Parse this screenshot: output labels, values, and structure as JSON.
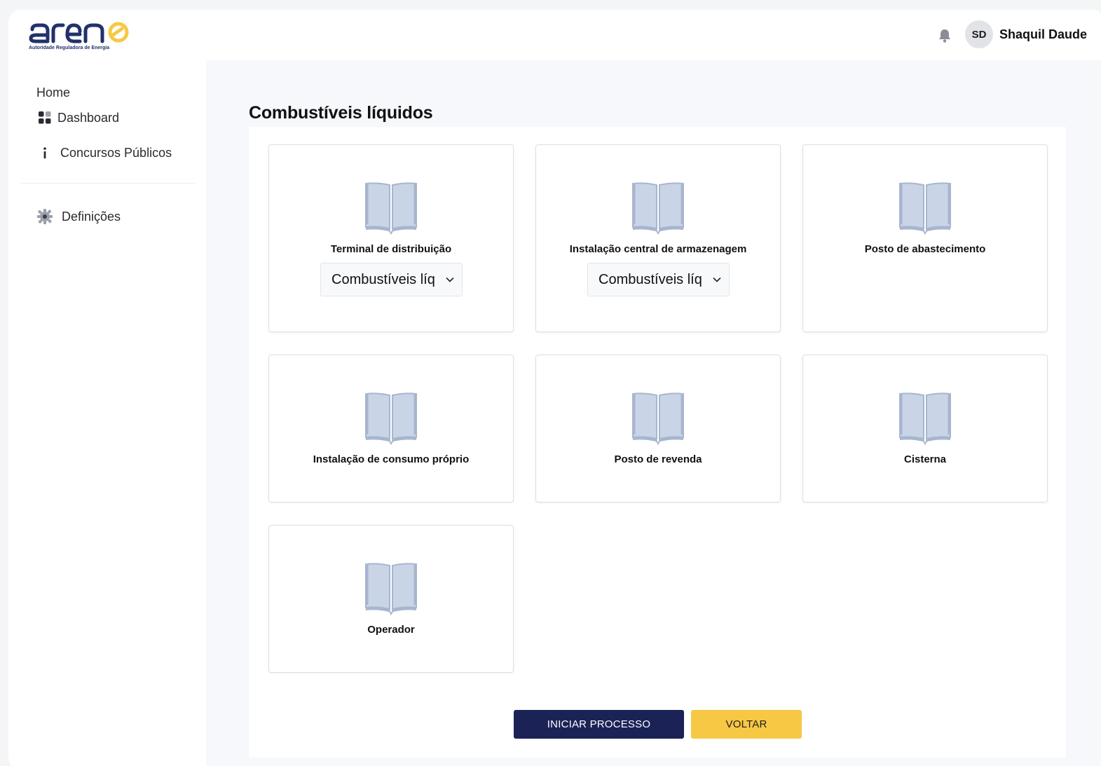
{
  "brand": {
    "logo_text": "arene",
    "subtitle": "Autoridade Reguladora de Energia",
    "primary": "#1b2356",
    "accent": "#f7c843"
  },
  "header": {
    "notification_icon": "bell-icon",
    "avatar_initials": "SD",
    "user_name": "Shaquil Daude"
  },
  "sidebar": {
    "section_label": "Home",
    "items": [
      {
        "label": "Dashboard",
        "icon": "grid-icon"
      },
      {
        "label": "Concursos Públicos",
        "icon": "info-icon"
      },
      {
        "label": "Definições",
        "icon": "gear-icon"
      }
    ]
  },
  "main": {
    "title": "Combustíveis líquidos",
    "cards": [
      {
        "label": "Terminal de distribuição",
        "icon": "book-icon",
        "select_value": "Combustíveis líq"
      },
      {
        "label": "Instalação central de armazenagem",
        "icon": "book-icon",
        "select_value": "Combustíveis líq"
      },
      {
        "label": "Posto de abastecimento",
        "icon": "book-icon"
      },
      {
        "label": "Instalação de consumo próprio",
        "icon": "book-icon"
      },
      {
        "label": "Posto de revenda",
        "icon": "book-icon"
      },
      {
        "label": "Cisterna",
        "icon": "book-icon"
      },
      {
        "label": "Operador",
        "icon": "book-icon"
      }
    ],
    "buttons": {
      "start": "INICIAR PROCESSO",
      "back": "VOLTAR"
    }
  }
}
